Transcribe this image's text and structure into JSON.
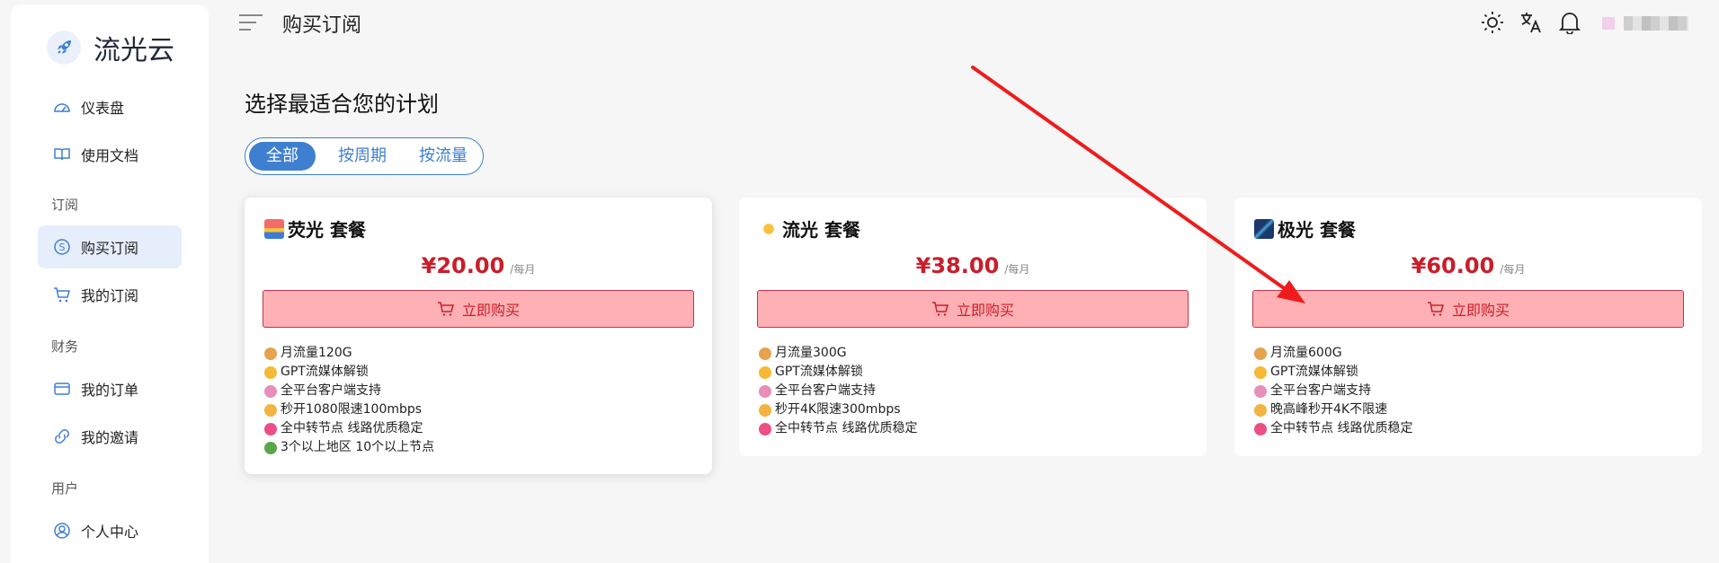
{
  "brand": {
    "name": "流光云"
  },
  "header": {
    "title": "购买订阅"
  },
  "sidebar": {
    "items": [
      {
        "label": "仪表盘",
        "icon": "dashboard-icon"
      },
      {
        "label": "使用文档",
        "icon": "book-icon"
      },
      {
        "group": "订阅"
      },
      {
        "label": "购买订阅",
        "icon": "dollar-circle-icon",
        "active": true
      },
      {
        "label": "我的订阅",
        "icon": "cart-icon"
      },
      {
        "group": "财务"
      },
      {
        "label": "我的订单",
        "icon": "wallet-icon"
      },
      {
        "label": "我的邀请",
        "icon": "invite-icon"
      },
      {
        "group": "用户"
      },
      {
        "label": "个人中心",
        "icon": "user-circle-icon"
      }
    ]
  },
  "main": {
    "heading": "选择最适合您的计划",
    "tabs": [
      {
        "label": "全部",
        "active": true
      },
      {
        "label": "按周期"
      },
      {
        "label": "按流量"
      }
    ],
    "plans": [
      {
        "name": "荧光 套餐",
        "price": "¥20.00",
        "period": "/每月",
        "button": "立即购买",
        "features": [
          "月流量120G",
          "GPT流媒体解锁",
          "全平台客户端支持",
          "秒开1080限速100mbps",
          "全中转节点 线路优质稳定",
          "3个以上地区 10个以上节点"
        ]
      },
      {
        "name": "流光 套餐",
        "price": "¥38.00",
        "period": "/每月",
        "button": "立即购买",
        "features": [
          "月流量300G",
          "GPT流媒体解锁",
          "全平台客户端支持",
          "秒开4K限速300mbps",
          "全中转节点 线路优质稳定"
        ]
      },
      {
        "name": "极光 套餐",
        "price": "¥60.00",
        "period": "/每月",
        "button": "立即购买",
        "features": [
          "月流量600G",
          "GPT流媒体解锁",
          "全平台客户端支持",
          "晚高峰秒开4K不限速",
          "全中转节点 线路优质稳定"
        ]
      }
    ]
  },
  "colors": {
    "accent": "#3f7fd0",
    "price": "#c81e2b",
    "buy_bg": "#ffb0b4",
    "annotation_arrow": "#ee1c1c"
  }
}
